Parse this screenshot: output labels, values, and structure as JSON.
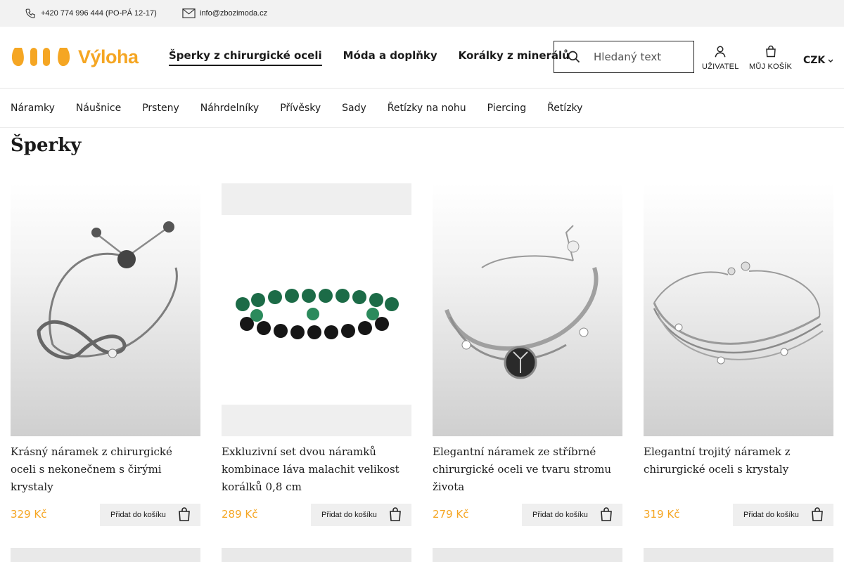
{
  "topbar": {
    "phone": "+420 774 996 444 (PO-PÁ 12-17)",
    "email": "info@zbozimoda.cz"
  },
  "header": {
    "logo_text": "Výloha",
    "nav": [
      {
        "label": "Šperky z chirurgické oceli",
        "active": true
      },
      {
        "label": "Móda a doplňky",
        "active": false
      },
      {
        "label": "Korálky z minerálů",
        "active": false
      }
    ],
    "search_placeholder": "Hledaný text",
    "user_label": "UŽIVATEL",
    "cart_label": "MŮJ KOŠÍK",
    "currency": "CZK"
  },
  "subnav": [
    "Náramky",
    "Náušnice",
    "Prsteny",
    "Náhrdelníky",
    "Přívěsky",
    "Sady",
    "Řetízky na nohu",
    "Piercing",
    "Řetízky"
  ],
  "page_title": "Šperky",
  "products": [
    {
      "name": "Krásný náramek z chirurgické oceli s nekonečnem s čirými krystaly",
      "price": "329 Kč",
      "button": "Přidat do košíku"
    },
    {
      "name": "Exkluzivní set dvou náramků kombinace láva malachit velikost korálků 0,8 cm",
      "price": "289 Kč",
      "button": "Přidat do košíku"
    },
    {
      "name": "Elegantní náramek ze stříbrné chirurgické oceli ve tvaru stromu života",
      "price": "279 Kč",
      "button": "Přidat do košíku"
    },
    {
      "name": "Elegantní trojitý náramek z chirurgické oceli s krystaly",
      "price": "319 Kč",
      "button": "Přidat do košíku"
    }
  ],
  "colors": {
    "accent": "#f5a623",
    "text": "#1a1a1a",
    "button_bg": "#efefef",
    "topbar_bg": "#f2f2f2"
  }
}
